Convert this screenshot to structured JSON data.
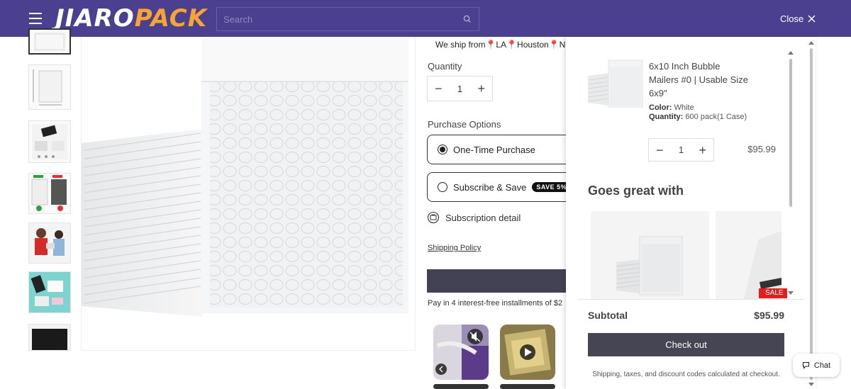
{
  "header": {
    "logo_part1": "JIARO",
    "logo_part2": "PACK",
    "search_placeholder": "Search",
    "close_label": "Close",
    "bg_color": "#4b3f8f",
    "accent_color": "#f7a435"
  },
  "product": {
    "shipping_text": "We ship from📍LA📍Houston📍New",
    "quantity_label": "Quantity",
    "quantity_value": "1",
    "purchase_options_label": "Purchase Options",
    "option_one_time": "One-Time Purchase",
    "option_subscribe": "Subscribe & Save",
    "save_badge": "SAVE 5%",
    "subscription_detail": "Subscription detail",
    "shipping_policy": "Shipping Policy",
    "installments_text": "Pay in 4 interest-free installments of $2"
  },
  "cart": {
    "item_title": "6x10 Inch Bubble Mailers #0 | Usable Size 6x9\"",
    "color_label": "Color:",
    "color_value": "White",
    "quantity_label": "Quantity:",
    "quantity_value": "600 pack(1 Case)",
    "item_qty": "1",
    "item_price": "$95.99",
    "goes_great_with": "Goes great with",
    "sale_label": "SALE",
    "subtotal_label": "Subtotal",
    "subtotal_value": "$95.99",
    "checkout_label": "Check out",
    "fine_print": "Shipping, taxes, and discount codes calculated at checkout."
  },
  "chat": {
    "label": "Chat"
  }
}
